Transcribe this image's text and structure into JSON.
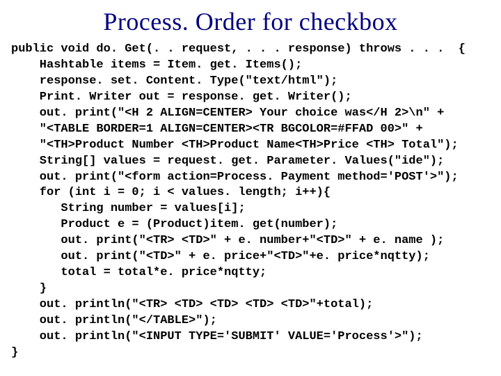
{
  "title": "Process. Order for checkbox",
  "code": {
    "l01": "public void do. Get(. . request, . . . response) throws . . .  {",
    "l02": "    Hashtable items = Item. get. Items();",
    "l03": "    response. set. Content. Type(\"text/html\");",
    "l04": "    Print. Writer out = response. get. Writer();",
    "l05": "    out. print(\"<H 2 ALIGN=CENTER> Your choice was</H 2>\\n\" +",
    "l06": "    \"<TABLE BORDER=1 ALIGN=CENTER><TR BGCOLOR=#FFAD 00>\" +",
    "l07": "    \"<TH>Product Number <TH>Product Name<TH>Price <TH> Total\");",
    "l08": "    String[] values = request. get. Parameter. Values(\"ide\");",
    "l09": "    out. print(\"<form action=Process. Payment method='POST'>\");",
    "l10": "    for (int i = 0; i < values. length; i++){",
    "l11": "       String number = values[i];",
    "l12": "       Product e = (Product)item. get(number);",
    "l13": "       out. print(\"<TR> <TD>\" + e. number+\"<TD>\" + e. name );",
    "l14": "       out. print(\"<TD>\" + e. price+\"<TD>\"+e. price*nqtty);",
    "l15": "       total = total*e. price*nqtty;",
    "l16": "    }",
    "l17": "    out. println(\"<TR> <TD> <TD> <TD> <TD>\"+total);",
    "l18": "    out. println(\"</TABLE>\");",
    "l19": "    out. println(\"<INPUT TYPE='SUBMIT' VALUE='Process'>\");",
    "l20": "}"
  }
}
